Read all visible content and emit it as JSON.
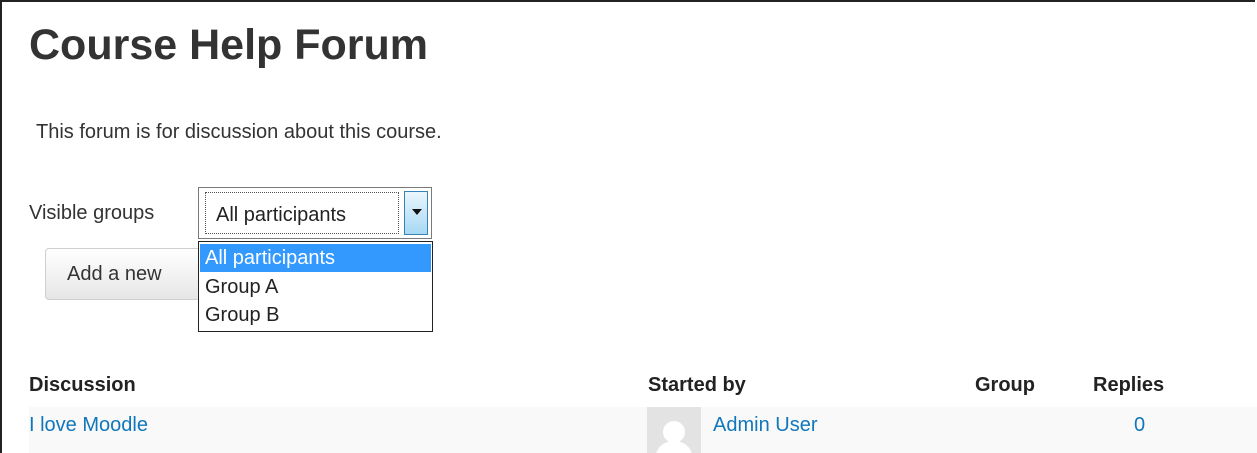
{
  "page": {
    "title": "Course Help Forum",
    "intro": "This forum is for discussion about this course."
  },
  "groups": {
    "label": "Visible groups",
    "selected": "All participants",
    "options": [
      "All participants",
      "Group A",
      "Group B"
    ]
  },
  "actions": {
    "add_label": "Add a new"
  },
  "table": {
    "headers": {
      "discussion": "Discussion",
      "started_by": "Started by",
      "group": "Group",
      "replies": "Replies"
    },
    "rows": [
      {
        "discussion": "I love Moodle",
        "started_by": "Admin User",
        "group": "",
        "replies": "0"
      }
    ]
  },
  "colors": {
    "link": "#1177bb",
    "highlight": "#3399ff"
  }
}
